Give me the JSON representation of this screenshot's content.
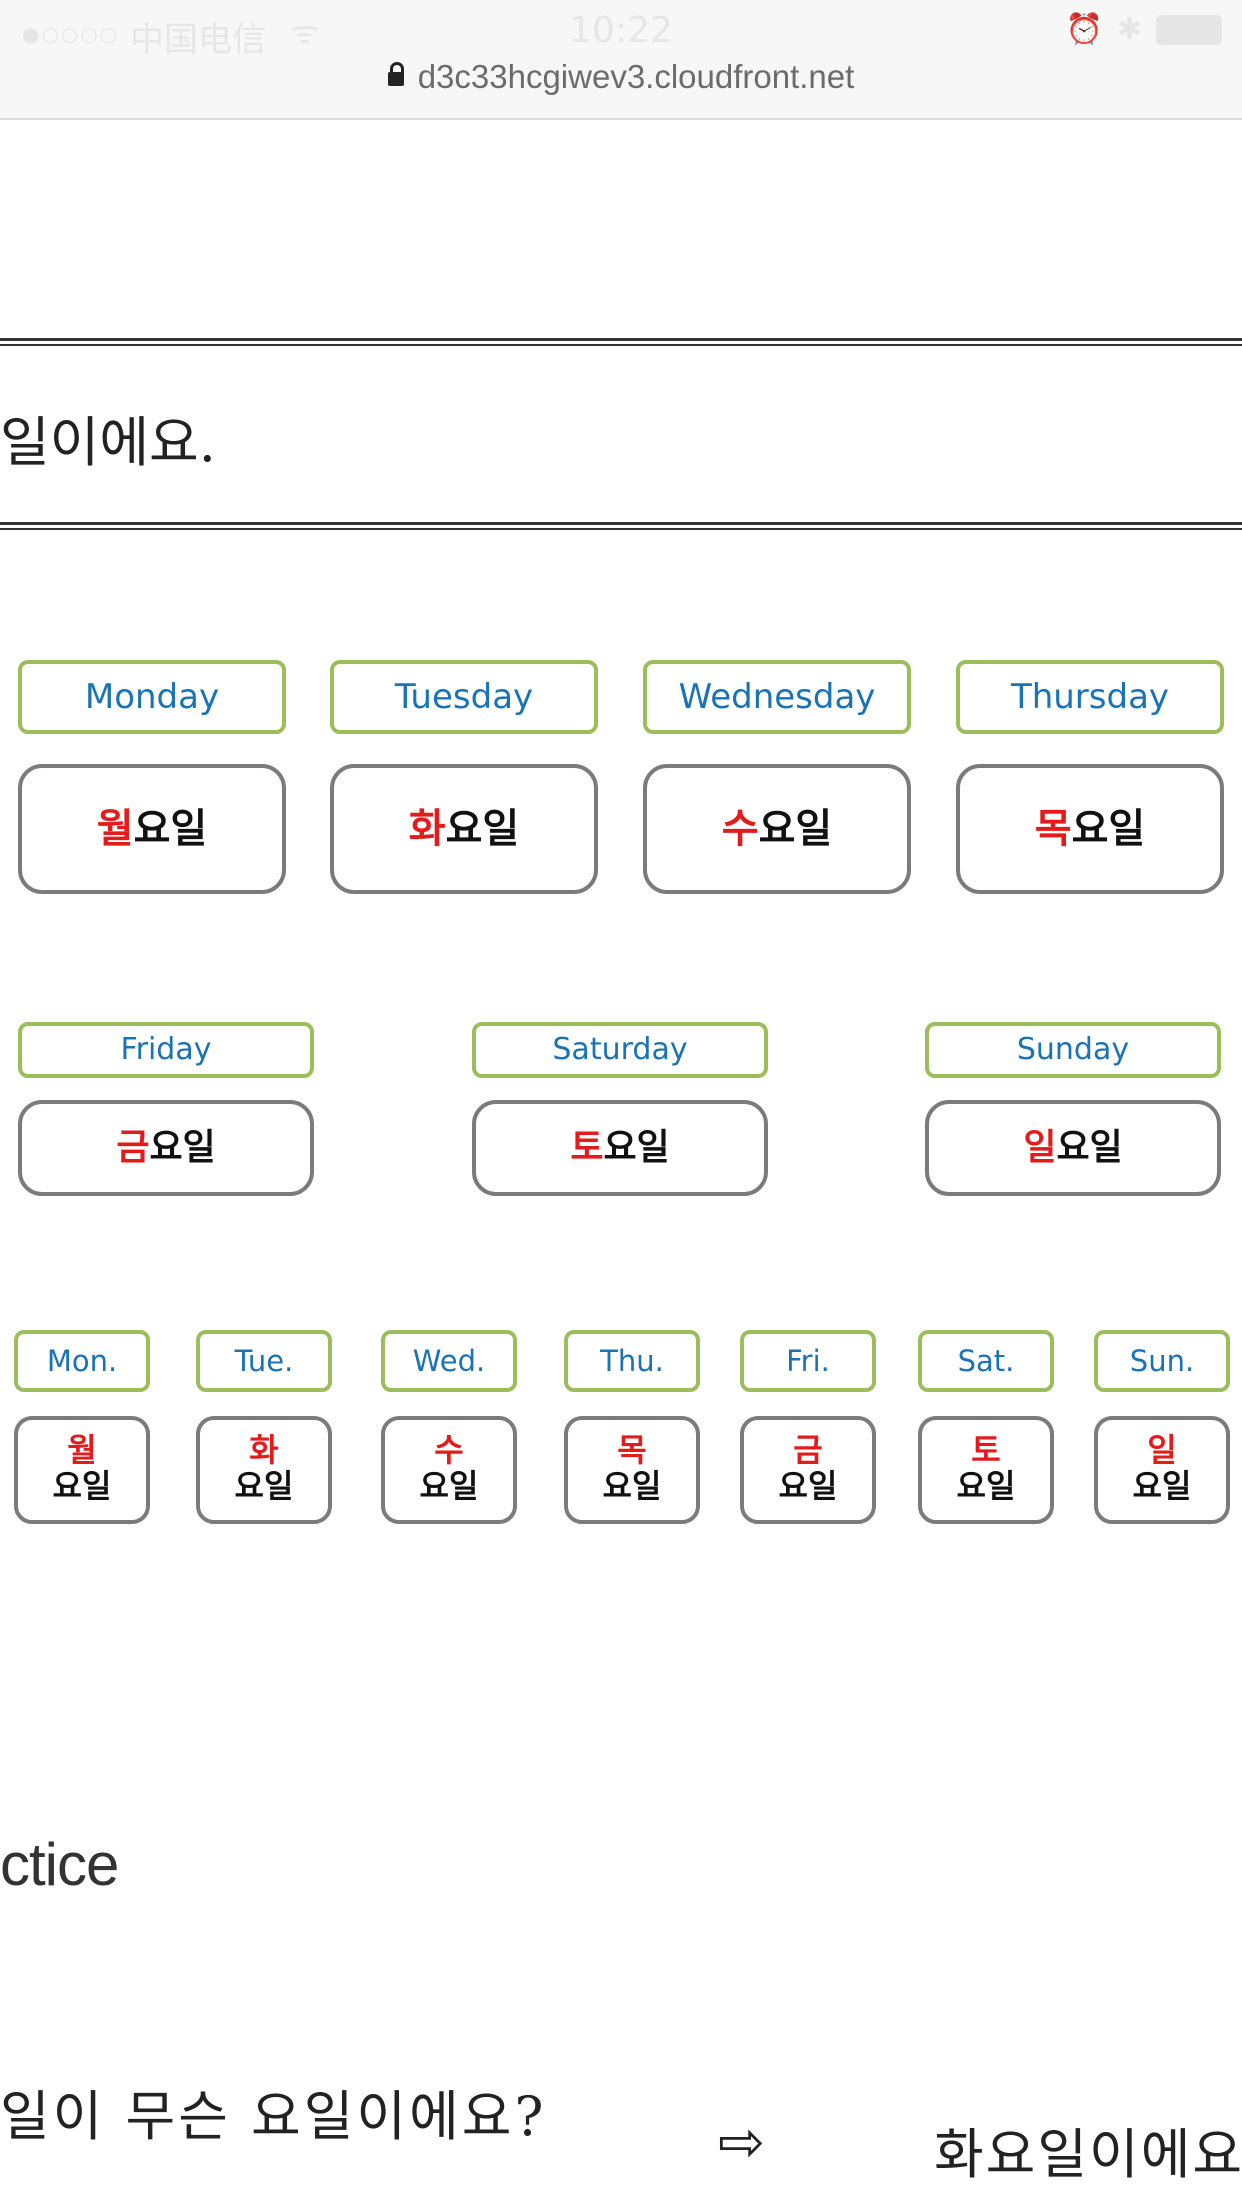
{
  "status_bar": {
    "signal": "●○○○○",
    "carrier": "中国电信",
    "wifi_icon": "wifi-icon",
    "time": "10:22",
    "alarm_icon": "alarm-icon",
    "bluetooth_icon": "bluetooth-icon",
    "battery_icon": "battery-icon"
  },
  "url_bar": {
    "url": "d3c33hcgiwev3.cloudfront.net",
    "lock_icon": "lock-icon"
  },
  "banner": {
    "text": "일이에요."
  },
  "full_days": [
    {
      "en": "Monday",
      "ko_red": "월",
      "ko_rest": "요일"
    },
    {
      "en": "Tuesday",
      "ko_red": "화",
      "ko_rest": "요일"
    },
    {
      "en": "Wednesday",
      "ko_red": "수",
      "ko_rest": "요일"
    },
    {
      "en": "Thursday",
      "ko_red": "목",
      "ko_rest": "요일"
    },
    {
      "en": "Friday",
      "ko_red": "금",
      "ko_rest": "요일"
    },
    {
      "en": "Saturday",
      "ko_red": "토",
      "ko_rest": "요일"
    },
    {
      "en": "Sunday",
      "ko_red": "일",
      "ko_rest": "요일"
    }
  ],
  "short_days": [
    {
      "en": "Mon.",
      "ko_red": "월",
      "ko_rest": "요일"
    },
    {
      "en": "Tue.",
      "ko_red": "화",
      "ko_rest": "요일"
    },
    {
      "en": "Wed.",
      "ko_red": "수",
      "ko_rest": "요일"
    },
    {
      "en": "Thu.",
      "ko_red": "목",
      "ko_rest": "요일"
    },
    {
      "en": "Fri.",
      "ko_red": "금",
      "ko_rest": "요일"
    },
    {
      "en": "Sat.",
      "ko_red": "토",
      "ko_rest": "요일"
    },
    {
      "en": "Sun.",
      "ko_red": "일",
      "ko_rest": "요일"
    }
  ],
  "practice": {
    "heading": "ctice"
  },
  "exercise": {
    "question": "일이 무슨 요일이에요?",
    "arrow": "⇨",
    "answer": "화요일이에요"
  },
  "colors": {
    "accent_red": "#e31b1b",
    "en_blue": "#1a73b5",
    "en_border": "#9cbe5a",
    "ko_border": "#7b7b7b"
  }
}
